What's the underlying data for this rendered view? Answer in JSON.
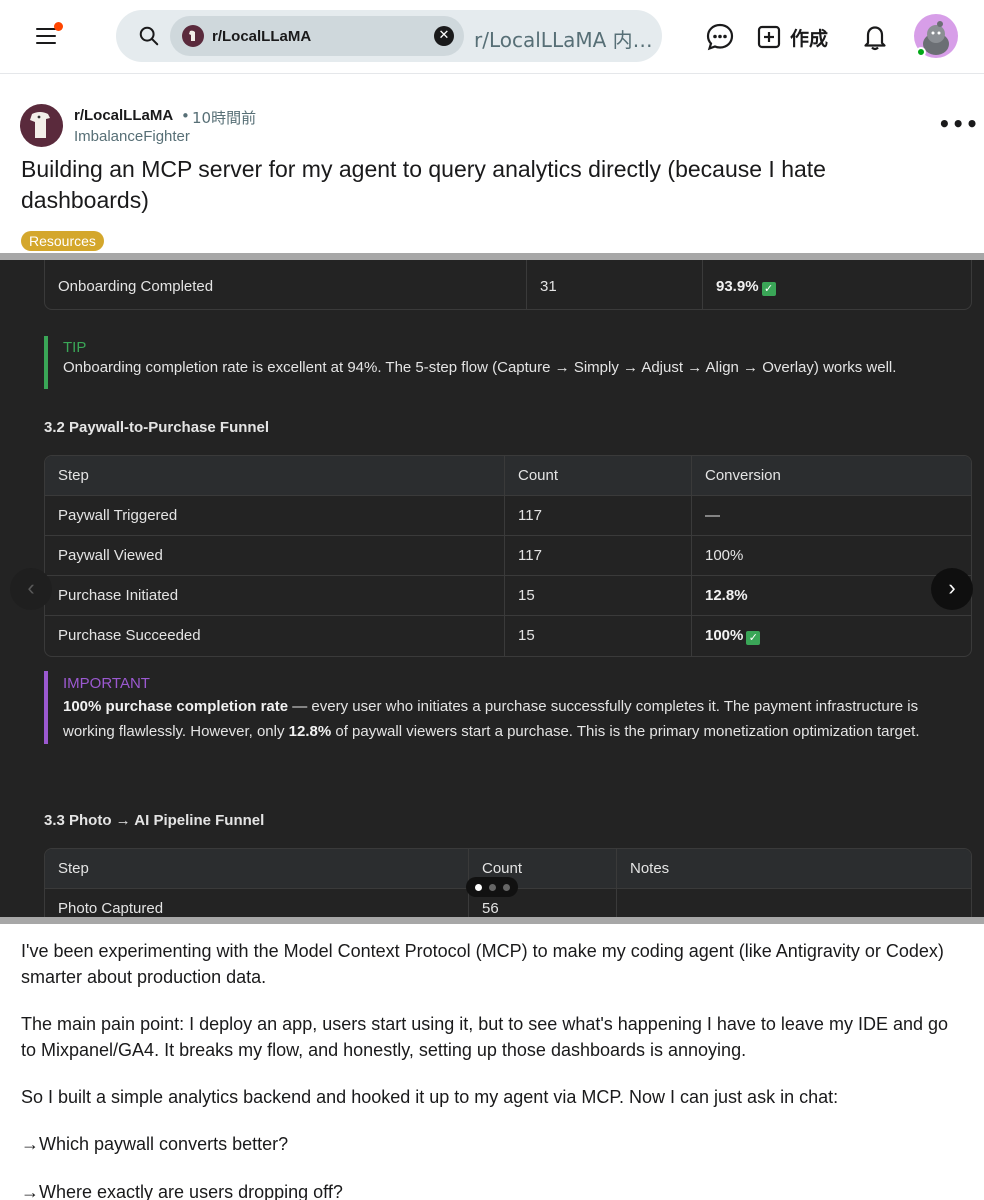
{
  "header": {
    "search_chip_label": "r/LocalLLaMA",
    "search_placeholder": "r/LocalLLaMA 内を検索してください",
    "create_label": "作成"
  },
  "post": {
    "subreddit": "r/LocalLLaMA",
    "time_ago": "10時間前",
    "author": "ImbalanceFighter",
    "title": "Building an MCP server for my agent to query analytics directly (because I hate dashboards)",
    "flair": "Resources",
    "flair_color": "#d4a72c"
  },
  "gallery": {
    "onboarding_row": {
      "step": "Onboarding Completed",
      "count": "31",
      "conversion": "93.9%"
    },
    "tip": {
      "tag": "TIP",
      "text": "Onboarding completion rate is excellent at 94%. The 5-step flow (Capture → Simply → Adjust → Align → Overlay) works well.",
      "color": "#3aa657"
    },
    "section_32": "3.2 Paywall-to-Purchase Funnel",
    "funnel_headers": [
      "Step",
      "Count",
      "Conversion"
    ],
    "funnel_rows": [
      {
        "step": "Paywall Triggered",
        "count": "117",
        "conversion": "—"
      },
      {
        "step": "Paywall Viewed",
        "count": "117",
        "conversion": "100%"
      },
      {
        "step": "Purchase Initiated",
        "count": "15",
        "conversion": "12.8%"
      },
      {
        "step": "Purchase Succeeded",
        "count": "15",
        "conversion": "100%"
      }
    ],
    "important": {
      "tag": "IMPORTANT",
      "bold1": "100% purchase completion rate",
      "text1": " — every user who initiates a purchase successfully completes it. The payment infrastructure is working flawlessly. However, only ",
      "bold2": "12.8%",
      "text2": " of paywall viewers start a purchase. This is the primary monetization optimization target.",
      "color": "#9b59d0"
    },
    "section_33": "3.3 Photo → AI Pipeline Funnel",
    "pipeline_headers": [
      "Step",
      "Count",
      "Notes"
    ],
    "pipeline_rows": [
      {
        "step": "Photo Captured",
        "count": "56",
        "notes": ""
      }
    ],
    "slide_count": 3,
    "current_slide": 1
  },
  "body": {
    "p1": "I've been experimenting with the Model Context Protocol (MCP) to make my coding agent (like Antigravity or Codex) smarter about production data.",
    "p2": "The main pain point: I deploy an app, users start using it, but to see what's happening I have to leave my IDE and go to Mixpanel/GA4. It breaks my flow, and honestly, setting up those dashboards is annoying.",
    "p3": "So I built a simple analytics backend and hooked it up to my agent via MCP. Now I can just ask in chat:",
    "q1": "→Which paywall converts better?",
    "q2": "→Where exactly are users dropping off?"
  }
}
